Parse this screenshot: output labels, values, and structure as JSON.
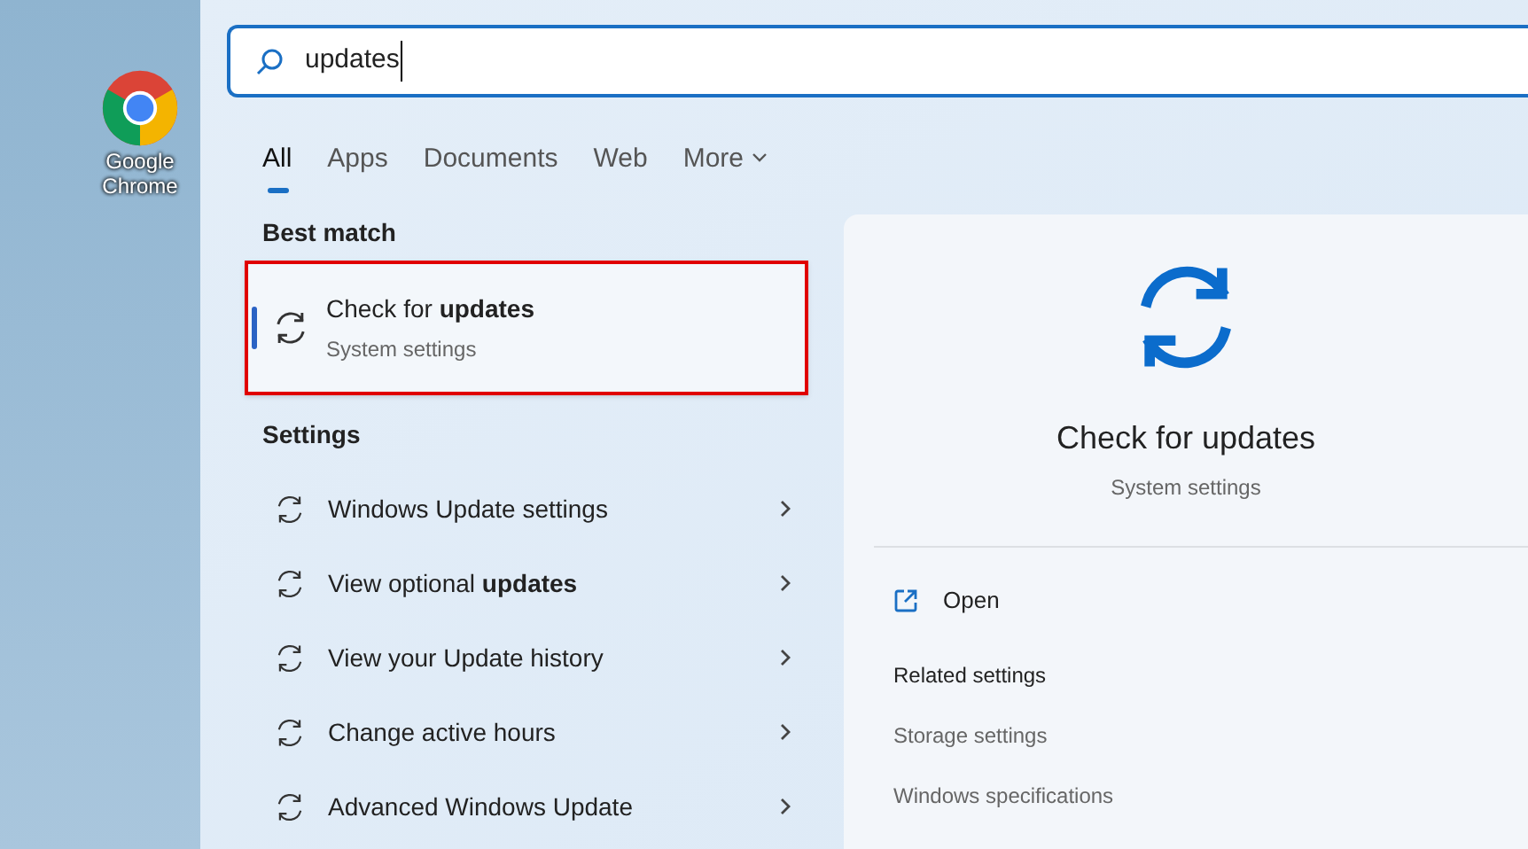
{
  "desktop": {
    "icons": [
      {
        "label": "Google Chrome"
      }
    ]
  },
  "search": {
    "value": "updates"
  },
  "tabs": [
    {
      "label": "All",
      "selected": true
    },
    {
      "label": "Apps",
      "selected": false
    },
    {
      "label": "Documents",
      "selected": false
    },
    {
      "label": "Web",
      "selected": false
    },
    {
      "label": "More",
      "selected": false,
      "dropdown": true
    }
  ],
  "best_match": {
    "heading": "Best match",
    "title": "Check for **updates**",
    "subtitle": "System settings",
    "selected": true,
    "highlighted": true
  },
  "settings": {
    "heading": "Settings",
    "items": [
      {
        "label": "Windows Update settings"
      },
      {
        "label": "View optional **updates**"
      },
      {
        "label": "View your Update history"
      },
      {
        "label": "Change active hours"
      },
      {
        "label": "Advanced Windows Update"
      }
    ]
  },
  "details": {
    "title": "Check for updates",
    "subtitle": "System settings",
    "actions": [
      {
        "label": "Open"
      }
    ],
    "related_heading": "Related settings",
    "related": [
      {
        "label": "Storage settings"
      },
      {
        "label": "Windows specifications"
      }
    ]
  }
}
